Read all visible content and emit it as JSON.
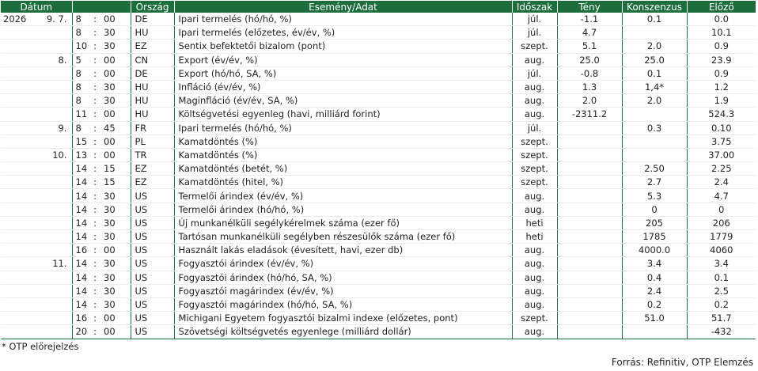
{
  "headers": {
    "date": "Dátum",
    "country": "Ország",
    "event": "Esemény/Adat",
    "period": "Időszak",
    "actual": "Tény",
    "consensus": "Konszenzus",
    "previous": "Előző"
  },
  "rows": [
    {
      "year": "2026",
      "md": "9.  7.",
      "h": "8",
      "m": "00",
      "country": "DE",
      "event": "Ipari termelés (hó/hó, %)",
      "period": "júl.",
      "actual": "-1.1",
      "consensus": "0.1",
      "previous": "0.0"
    },
    {
      "year": "",
      "md": "",
      "h": "8",
      "m": "30",
      "country": "HU",
      "event": "Ipari termelés (előzetes, év/év, %)",
      "period": "júl.",
      "actual": "4.7",
      "consensus": "",
      "previous": "10.1"
    },
    {
      "year": "",
      "md": "",
      "h": "10",
      "m": "30",
      "country": "EZ",
      "event": "Sentix befektetői bizalom (pont)",
      "period": "szept.",
      "actual": "5.1",
      "consensus": "2.0",
      "previous": "0.9"
    },
    {
      "year": "",
      "md": "8.",
      "h": "5",
      "m": "00",
      "country": "CN",
      "event": "Export (év/év, %)",
      "period": "aug.",
      "actual": "25.0",
      "consensus": "25.0",
      "previous": "23.9"
    },
    {
      "year": "",
      "md": "",
      "h": "8",
      "m": "00",
      "country": "DE",
      "event": "Export (hó/hó, SA, %)",
      "period": "júl.",
      "actual": "-0.8",
      "consensus": "0.1",
      "previous": "0.9"
    },
    {
      "year": "",
      "md": "",
      "h": "8",
      "m": "30",
      "country": "HU",
      "event": "Infláció (év/év, %)",
      "period": "aug.",
      "actual": "1.3",
      "consensus": "1,4*",
      "previous": "1.2"
    },
    {
      "year": "",
      "md": "",
      "h": "8",
      "m": "30",
      "country": "HU",
      "event": "Maginfláció (év/év, SA, %)",
      "period": "aug.",
      "actual": "2.0",
      "consensus": "2.0",
      "previous": "1.9"
    },
    {
      "year": "",
      "md": "",
      "h": "11",
      "m": "00",
      "country": "HU",
      "event": "Költségvetési egyenleg (havi, milliárd forint)",
      "period": "aug.",
      "actual": "-2311.2",
      "consensus": "",
      "previous": "524.3"
    },
    {
      "year": "",
      "md": "9.",
      "h": "8",
      "m": "45",
      "country": "FR",
      "event": "Ipari termelés  (hó/hó, %)",
      "period": "júl.",
      "actual": "",
      "consensus": "0.3",
      "previous": "0.10"
    },
    {
      "year": "",
      "md": "",
      "h": "15",
      "m": "00",
      "country": "PL",
      "event": "Kamatdöntés (%)",
      "period": "szept.",
      "actual": "",
      "consensus": "",
      "previous": "3.75"
    },
    {
      "year": "",
      "md": "10.",
      "h": "13",
      "m": "00",
      "country": "TR",
      "event": "Kamatdöntés (%)",
      "period": "szept.",
      "actual": "",
      "consensus": "",
      "previous": "37.00"
    },
    {
      "year": "",
      "md": "",
      "h": "14",
      "m": "15",
      "country": "EZ",
      "event": "Kamatdöntés (betét, %)",
      "period": "szept.",
      "actual": "",
      "consensus": "2.50",
      "previous": "2.25"
    },
    {
      "year": "",
      "md": "",
      "h": "14",
      "m": "15",
      "country": "EZ",
      "event": "Kamatdöntés (hitel, %)",
      "period": "szept.",
      "actual": "",
      "consensus": "2.7",
      "previous": "2.4"
    },
    {
      "year": "",
      "md": "",
      "h": "14",
      "m": "30",
      "country": "US",
      "event": "Termelői árindex (év/év, %)",
      "period": "aug.",
      "actual": "",
      "consensus": "5.3",
      "previous": "4.7"
    },
    {
      "year": "",
      "md": "",
      "h": "14",
      "m": "30",
      "country": "US",
      "event": "Termelői árindex (hó/hó, %)",
      "period": "aug.",
      "actual": "",
      "consensus": "0",
      "previous": "0"
    },
    {
      "year": "",
      "md": "",
      "h": "14",
      "m": "30",
      "country": "US",
      "event": "Új munkanélküli segélykérelmek száma (ezer fő)",
      "period": "heti",
      "actual": "",
      "consensus": "205",
      "previous": "206"
    },
    {
      "year": "",
      "md": "",
      "h": "14",
      "m": "30",
      "country": "US",
      "event": "Tartósan munkanélküli segélyben részesülők száma (ezer fő)",
      "period": "heti",
      "actual": "",
      "consensus": "1785",
      "previous": "1779"
    },
    {
      "year": "",
      "md": "",
      "h": "16",
      "m": "00",
      "country": "US",
      "event": "Használt lakás eladások (évesített, havi, ezer db)",
      "period": "aug.",
      "actual": "",
      "consensus": "4000.0",
      "previous": "4060"
    },
    {
      "year": "",
      "md": "11.",
      "h": "14",
      "m": "30",
      "country": "US",
      "event": "Fogyasztói árindex (év/év, %)",
      "period": "aug.",
      "actual": "",
      "consensus": "3.4",
      "previous": "3.4"
    },
    {
      "year": "",
      "md": "",
      "h": "14",
      "m": "30",
      "country": "US",
      "event": "Fogyasztói árindex (hó/hó, SA, %)",
      "period": "aug.",
      "actual": "",
      "consensus": "0.4",
      "previous": "0.1"
    },
    {
      "year": "",
      "md": "",
      "h": "14",
      "m": "30",
      "country": "US",
      "event": "Fogyasztói magárindex (év/év, %)",
      "period": "aug.",
      "actual": "",
      "consensus": "2.4",
      "previous": "2.5"
    },
    {
      "year": "",
      "md": "",
      "h": "14",
      "m": "30",
      "country": "US",
      "event": "Fogyasztói magárindex (hó/hó, SA, %)",
      "period": "aug.",
      "actual": "",
      "consensus": "0.2",
      "previous": "0.2"
    },
    {
      "year": "",
      "md": "",
      "h": "16",
      "m": "00",
      "country": "US",
      "event": "Michigani Egyetem fogyasztói bizalmi indexe (előzetes, pont)",
      "period": "szept.",
      "actual": "",
      "consensus": "51.0",
      "previous": "51.7"
    },
    {
      "year": "",
      "md": "",
      "h": "20",
      "m": "00",
      "country": "US",
      "event": "Szövetségi költségvetés egyenlege (milliárd dollár)",
      "period": "aug.",
      "actual": "",
      "consensus": "",
      "previous": "-432"
    }
  ],
  "time_separator": ":",
  "footnote": "* OTP előrejelzés",
  "source": "Forrás: Refinitiv, OTP Elemzés"
}
